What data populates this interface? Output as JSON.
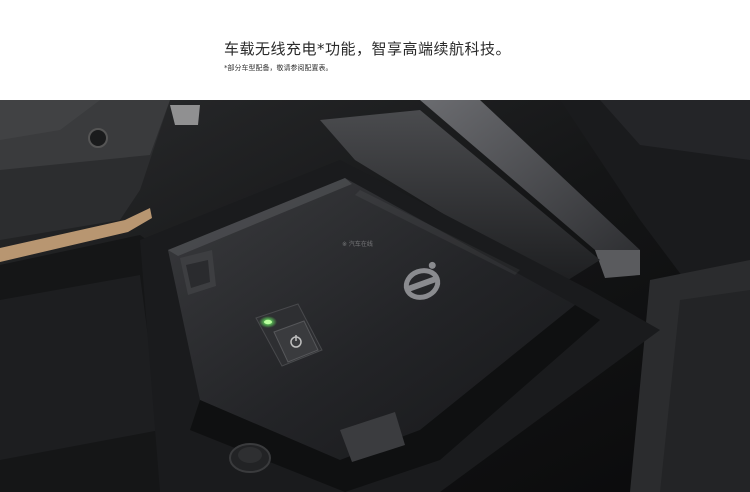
{
  "header": {
    "headline": "车载无线充电*功能，智享高端续航科技。",
    "footnote": "*部分车型配备，敬请参阅配置表。"
  },
  "photo": {
    "subject": "wireless-charging-tray",
    "watermark": "※ 汽车在线",
    "accent_colors": {
      "indicator_led": "#5fd35a",
      "trim_strip": "#c9a37a",
      "tray": "#1c1d1f",
      "pad": "#2a2b2e"
    }
  }
}
